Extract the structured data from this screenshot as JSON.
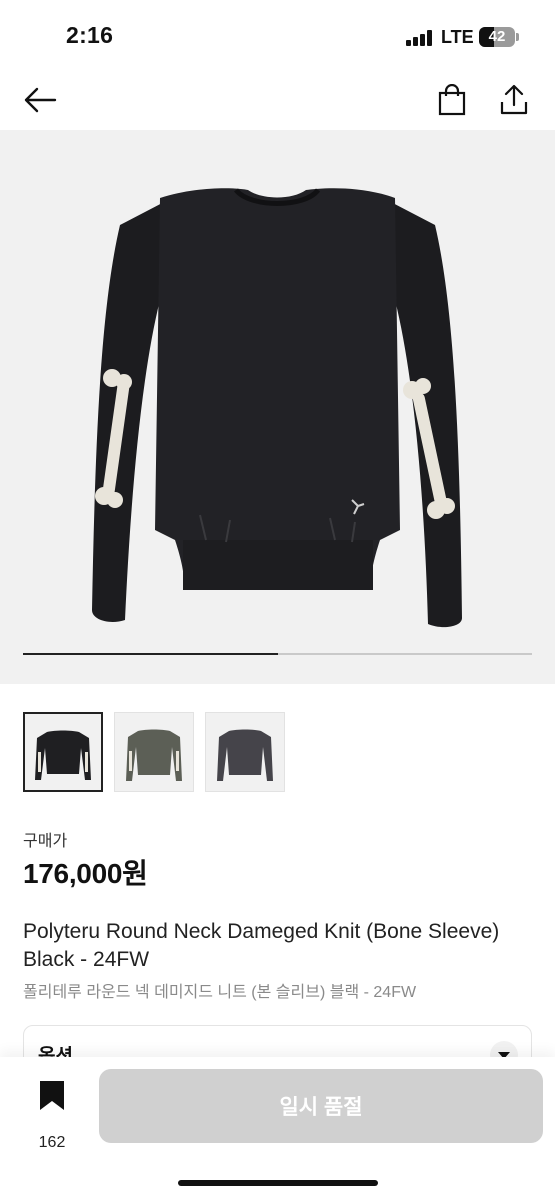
{
  "status": {
    "time": "2:16",
    "network": "LTE",
    "battery": "42",
    "battery_level": 0.42
  },
  "nav": {
    "back_icon": "arrow-left-icon",
    "cart_icon": "shopping-bag-icon",
    "share_icon": "share-icon"
  },
  "gallery": {
    "progress": 0.5,
    "main_product_color": "#1f1f22",
    "bone_color": "#e8e4da"
  },
  "thumbnails": [
    {
      "color": "#1f1f22",
      "selected": true
    },
    {
      "color": "#5c5f56",
      "selected": false
    },
    {
      "color": "#45444a",
      "selected": false
    }
  ],
  "product": {
    "price_label": "구매가",
    "price": "176,000원",
    "title_en": "Polyteru Round Neck Dameged Knit (Bone Sleeve) Black - 24FW",
    "title_ko": "폴리테루 라운드 넥 데미지드 니트 (본 슬리브) 블랙 - 24FW"
  },
  "option": {
    "label": "옵션"
  },
  "bottom": {
    "bookmark_count": "162",
    "sold_out_label": "일시 품절"
  }
}
